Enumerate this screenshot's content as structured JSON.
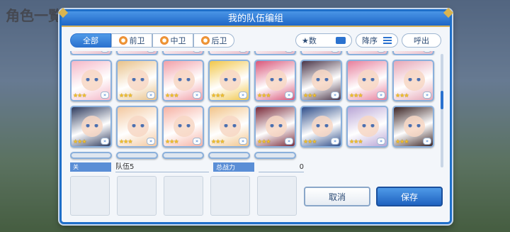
{
  "background": {
    "title": "角色一覧"
  },
  "dialog": {
    "title": "我的队伍编组"
  },
  "filters": {
    "tabs": [
      {
        "label": "全部",
        "active": true
      },
      {
        "label": "前卫",
        "active": false
      },
      {
        "label": "中卫",
        "active": false
      },
      {
        "label": "后卫",
        "active": false
      }
    ]
  },
  "sort": {
    "key_label": "★数",
    "order_label": "降序",
    "callout_label": "呼出"
  },
  "characters": {
    "rows": [
      {
        "stars": [
          "★★★",
          "★★★",
          "★★★",
          "★★★",
          "★★★",
          "★★★",
          "★★★",
          "★★★"
        ]
      },
      {
        "stars": [
          "★★★",
          "★★★",
          "★★★",
          "★★★",
          "★★★",
          "★★★",
          "★★★",
          "★★★"
        ],
        "colors": [
          "#f4b7c7",
          "#e9c28a",
          "#f1a0a8",
          "#f2c74b",
          "#d9577a",
          "#4a3548",
          "#e77f9c",
          "#e6a6b6"
        ]
      },
      {
        "stars": [
          "★★★",
          "★★★",
          "★★★",
          "★★★",
          "★★★",
          "★★★",
          "★★★",
          "★★★"
        ],
        "colors": [
          "#2e3b5e",
          "#f3c8a0",
          "#f6b2a4",
          "#f2c48a",
          "#7a2b3a",
          "#2f4e8a",
          "#b9a6d6",
          "#3b2424"
        ]
      }
    ]
  },
  "team": {
    "tag": "关",
    "name": "队伍5",
    "power_label": "总战力",
    "power_value": "0"
  },
  "buttons": {
    "cancel": "取消",
    "save": "保存"
  }
}
